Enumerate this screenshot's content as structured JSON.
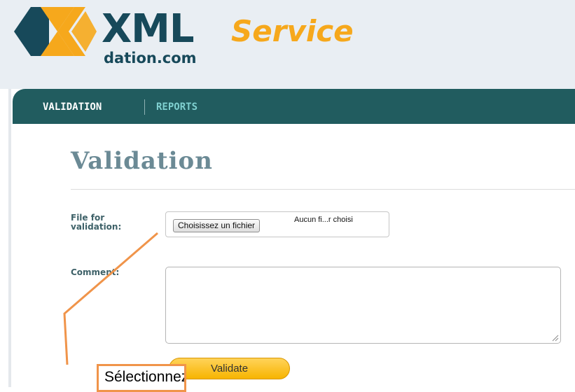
{
  "logo": {
    "brand": "XML",
    "subtitle": "dation.com",
    "service": "Service"
  },
  "nav": {
    "items": [
      {
        "label": "VALIDATION",
        "active": true
      },
      {
        "label": "REPORTS",
        "active": false
      }
    ]
  },
  "page": {
    "title": "Validation"
  },
  "form": {
    "file_label_line1": "File for",
    "file_label_line2": "validation:",
    "file_button": "Choisissez un fichier",
    "file_status": "Aucun fi...r choisi",
    "comment_label": "Comment:",
    "comment_value": "",
    "validate_button": "Validate"
  },
  "annotation": {
    "text": "Sélectionnez"
  },
  "colors": {
    "nav_bg": "#215c5f",
    "brand_dark": "#17495a",
    "brand_orange": "#f6a81c",
    "annotation_orange": "#f0944a"
  }
}
